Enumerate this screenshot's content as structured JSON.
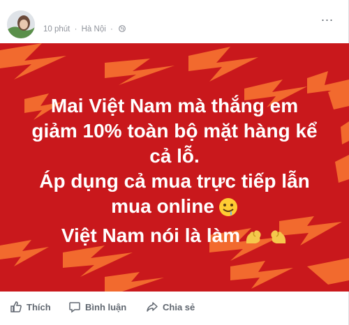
{
  "post": {
    "time": "10 phút",
    "separator": "·",
    "location": "Hà Nội",
    "more_label": "...",
    "message_lines": [
      "Mai Việt Nam mà thắng em",
      "giảm 10% toàn bộ mặt hàng kể",
      "cả lỗ.",
      "Áp dụng cả mua trực tiếp lẫn",
      "mua online",
      "Việt Nam nói là làm"
    ],
    "banner_color": "#c9181c",
    "bolt_color": "#f26a2e"
  },
  "actions": {
    "like": "Thích",
    "comment": "Bình luận",
    "share": "Chia sẻ"
  },
  "icons": [
    "globe-icon",
    "more-icon",
    "drool-emoji",
    "flexed-biceps-emoji",
    "like-icon",
    "comment-icon",
    "share-icon"
  ]
}
